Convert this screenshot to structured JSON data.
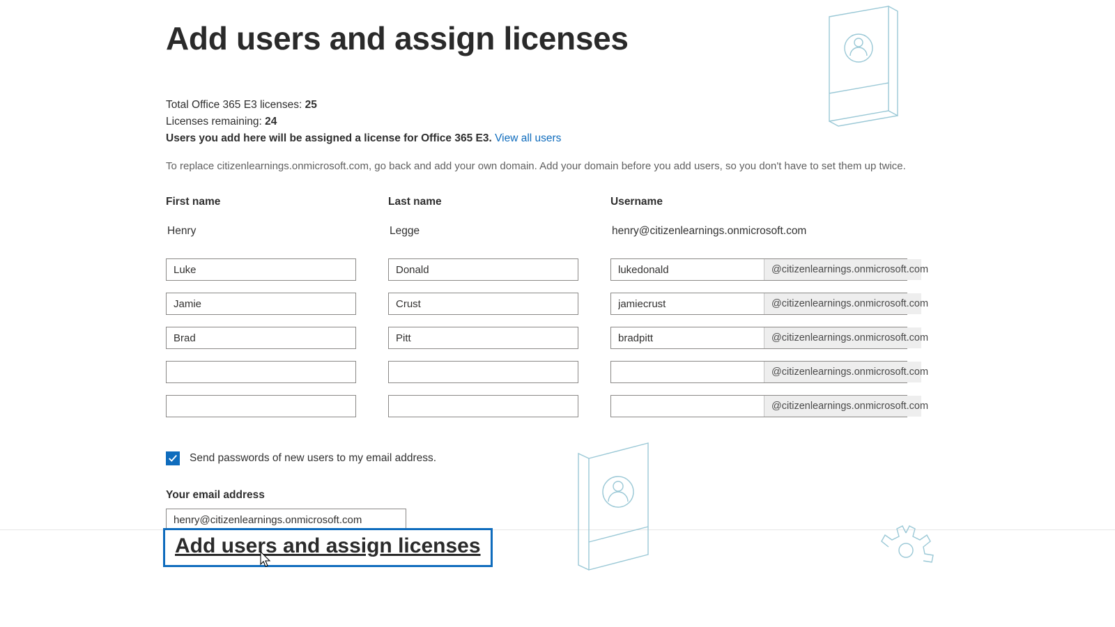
{
  "title": "Add users and assign licenses",
  "licenses": {
    "total_label": "Total Office 365 E3 licenses: ",
    "total_value": "25",
    "remaining_label": "Licenses remaining: ",
    "remaining_value": "24",
    "assign_note_prefix": "Users you add here will be assigned a license for Office 365 E3. ",
    "view_all_link": "View all users"
  },
  "replace_note": "To replace citizenlearnings.onmicrosoft.com, go back and add your own domain. Add your domain before you add users, so you don't have to set them up twice.",
  "columns": {
    "first": "First name",
    "last": "Last name",
    "user": "Username"
  },
  "static_row": {
    "first": "Henry",
    "last": "Legge",
    "user": "henry@citizenlearnings.onmicrosoft.com"
  },
  "domain_suffix": "@citizenlearnings.onmicrosoft.com",
  "rows": [
    {
      "first": "Luke",
      "last": "Donald",
      "user": "lukedonald"
    },
    {
      "first": "Jamie",
      "last": "Crust",
      "user": "jamiecrust"
    },
    {
      "first": "Brad",
      "last": "Pitt",
      "user": "bradpitt"
    },
    {
      "first": "",
      "last": "",
      "user": ""
    },
    {
      "first": "",
      "last": "",
      "user": ""
    }
  ],
  "send_passwords": {
    "checked": true,
    "label": "Send passwords of new users to my email address."
  },
  "email": {
    "label": "Your email address",
    "value": "henry@citizenlearnings.onmicrosoft.com"
  },
  "submit_label": "Add users and assign licenses"
}
